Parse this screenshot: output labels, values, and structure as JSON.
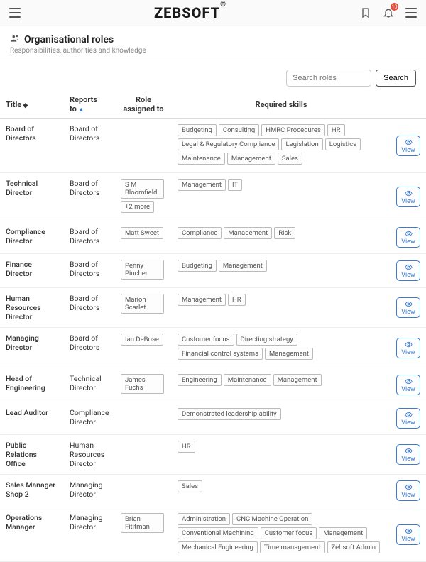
{
  "header": {
    "brand": "ZEBSOFT",
    "brand_sup": "®",
    "notification_count": "10"
  },
  "page": {
    "title": "Organisational roles",
    "subtitle": "Responsibilities, authorities and knowledge"
  },
  "search": {
    "placeholder": "Search roles",
    "button": "Search"
  },
  "columns": {
    "title": "Title",
    "reports_to": "Reports to",
    "assigned": "Role assigned to",
    "skills": "Required skills"
  },
  "view_label": "View",
  "rows": [
    {
      "title": "Board of Directors",
      "reports_to": "Board of Directors",
      "assigned": [],
      "skills": [
        "Budgeting",
        "Consulting",
        "HMRC Procedures",
        "HR",
        "Legal & Regulatory Compliance",
        "Legislation",
        "Logistics",
        "Maintenance",
        "Management",
        "Sales"
      ]
    },
    {
      "title": "Technical Director",
      "reports_to": "Board of Directors",
      "assigned": [
        "S M Bloomfield",
        "+2 more"
      ],
      "skills": [
        "Management",
        "IT"
      ]
    },
    {
      "title": "Compliance Director",
      "reports_to": "Board of Directors",
      "assigned": [
        "Matt Sweet"
      ],
      "skills": [
        "Compliance",
        "Management",
        "Risk"
      ]
    },
    {
      "title": "Finance Director",
      "reports_to": "Board of Directors",
      "assigned": [
        "Penny Pincher"
      ],
      "skills": [
        "Budgeting",
        "Management"
      ]
    },
    {
      "title": "Human Resources Director",
      "reports_to": "Board of Directors",
      "assigned": [
        "Marion Scarlet"
      ],
      "skills": [
        "Management",
        "HR"
      ]
    },
    {
      "title": "Managing Director",
      "reports_to": "Board of Directors",
      "assigned": [
        "Ian DeBose"
      ],
      "skills": [
        "Customer focus",
        "Directing strategy",
        "Financial control systems",
        "Management"
      ]
    },
    {
      "title": "Head of Engineering",
      "reports_to": "Technical Director",
      "assigned": [
        "James Fuchs"
      ],
      "skills": [
        "Engineering",
        "Maintenance",
        "Management"
      ]
    },
    {
      "title": "Lead Auditor",
      "reports_to": "Compliance Director",
      "assigned": [],
      "skills": [
        "Demonstrated leadership ability"
      ]
    },
    {
      "title": "Public Relations Office",
      "reports_to": "Human Resources Director",
      "assigned": [],
      "skills": [
        "HR"
      ]
    },
    {
      "title": "Sales Manager Shop 2",
      "reports_to": "Managing Director",
      "assigned": [],
      "skills": [
        "Sales"
      ]
    },
    {
      "title": "Operations Manager",
      "reports_to": "Managing Director",
      "assigned": [
        "Brian Fititman"
      ],
      "skills": [
        "Administration",
        "CNC Machine Operation",
        "Conventional Machining",
        "Customer focus",
        "Management",
        "Mechanical Engineering",
        "Time management",
        "Zebsoft Admin"
      ]
    }
  ]
}
